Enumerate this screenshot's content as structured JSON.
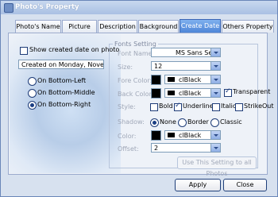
{
  "window": {
    "title": "Photo's Property"
  },
  "tabs": [
    {
      "label": "Photo's Name"
    },
    {
      "label": "Picture"
    },
    {
      "label": "Description"
    },
    {
      "label": "Background"
    },
    {
      "label": "Create Date"
    },
    {
      "label": "Others Property"
    }
  ],
  "active_tab": "Create Date",
  "date": {
    "show_label": "Show created date on photo",
    "show_checked": false,
    "text_value": "Created on  Monday, November 26",
    "positions": [
      {
        "label": "On Bottom-Left",
        "checked": false
      },
      {
        "label": "On Bottom-Middle",
        "checked": false
      },
      {
        "label": "On Bottom-Right",
        "checked": true
      }
    ]
  },
  "font": {
    "group_title": "Fonts Setting",
    "name_label": "Font Name:",
    "name_value": "MS Sans Serif",
    "size_label": "Size:",
    "size_value": "12",
    "fore_label": "Fore Color:",
    "fore_value": "clBlack",
    "back_label": "Back Color:",
    "back_value": "clBlack",
    "transparent_label": "Transparent",
    "transparent_checked": true,
    "style_label": "Style:",
    "styles": [
      {
        "label": "Bold",
        "checked": false
      },
      {
        "label": "Underline",
        "checked": true
      },
      {
        "label": "Italic",
        "checked": false
      },
      {
        "label": "StrikeOut",
        "checked": false
      }
    ],
    "shadow_label": "Shadow:",
    "shadow_options": [
      {
        "label": "None",
        "checked": true
      },
      {
        "label": "Border",
        "checked": false
      },
      {
        "label": "Classic",
        "checked": false
      }
    ],
    "color_label": "Color:",
    "color_value": "clBlack",
    "offset_label": "Offset:",
    "offset_value": "2",
    "use_all_label": "Use This Setting to all Photos"
  },
  "buttons": {
    "apply": "Apply",
    "close": "Close"
  },
  "colors": {
    "accent": "#4e86d8",
    "swatch": "#000000"
  }
}
